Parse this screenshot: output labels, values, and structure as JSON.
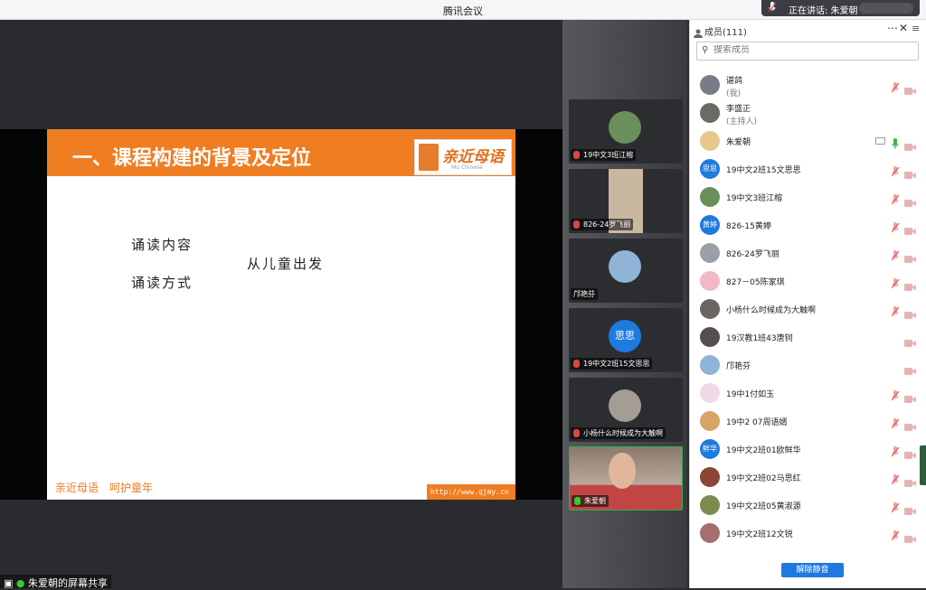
{
  "window": {
    "title": "腾讯会议"
  },
  "speaking": {
    "text": "正在讲话: 朱爱朝"
  },
  "share": {
    "label": "朱爱朝的屏幕共享"
  },
  "slide": {
    "title": "一、课程构建的背景及定位",
    "logo_text": "亲近母语",
    "logo_sub": "Mu Chinese",
    "lines": [
      "诵读内容",
      "从儿童出发",
      "诵读方式"
    ],
    "footer_left": "亲近母语　呵护童年",
    "footer_right": "http://www.qjmy.cn"
  },
  "tiles": [
    {
      "name": "19中文3班江榕",
      "mic": "muted",
      "avatar_color": "#6b8f5a"
    },
    {
      "name": "826-24罗飞丽",
      "mic": "muted",
      "avatar_color": "#c9b7a0"
    },
    {
      "name": "邝艳芬",
      "mic": "none",
      "avatar_color": "#8fb4d8"
    },
    {
      "name": "19中文2班15文思思",
      "mic": "muted",
      "avatar_text": "思思",
      "avatar_color": "#1f7ae0"
    },
    {
      "name": "小杨什么时候成为大触啊",
      "mic": "muted",
      "avatar_color": "#a49d94"
    },
    {
      "name": "朱爱朝",
      "mic": "on",
      "avatar_color": "#a45545"
    }
  ],
  "members": {
    "title": "成员(111)",
    "search_placeholder": "搜索成员",
    "unmute_all": "解除静音",
    "list": [
      {
        "name": "谌鸽",
        "sub": "(我)",
        "avatar_color": "#777d86",
        "mic": "muted",
        "cam": true
      },
      {
        "name": "李盛正",
        "sub": "(主持人)",
        "avatar_color": "#6d6a66",
        "mic": "none",
        "cam": false
      },
      {
        "name": "朱爱朝",
        "avatar_color": "#e8c88a",
        "mic": "on",
        "cam": true,
        "screen": true
      },
      {
        "name": "19中文2班15文思思",
        "avatar_text": "思思",
        "avatar_color": "#1f7ae0",
        "mic": "muted",
        "cam": true
      },
      {
        "name": "19中文3班江榕",
        "avatar_color": "#6b8f5a",
        "mic": "muted",
        "cam": true
      },
      {
        "name": "826-15黄婷",
        "avatar_text": "黄婷",
        "avatar_color": "#1f7ae0",
        "mic": "muted",
        "cam": true
      },
      {
        "name": "826-24罗飞丽",
        "avatar_color": "#9aa0a8",
        "mic": "muted",
        "cam": true
      },
      {
        "name": "827－05陈家琪",
        "avatar_color": "#f1b9c6",
        "mic": "muted",
        "cam": true
      },
      {
        "name": "小杨什么时候成为大触啊",
        "avatar_color": "#6a6562",
        "mic": "muted",
        "cam": true
      },
      {
        "name": "19汉教1班43唐钶",
        "avatar_color": "#55504e",
        "mic": "none",
        "cam": true
      },
      {
        "name": "邝艳芬",
        "avatar_color": "#8fb4d8",
        "mic": "none",
        "cam": true
      },
      {
        "name": "19中1付如玉",
        "avatar_color": "#f0d9e8",
        "mic": "muted",
        "cam": true
      },
      {
        "name": "19中2 07周语婿",
        "avatar_color": "#d6a468",
        "mic": "muted",
        "cam": true
      },
      {
        "name": "19中文2班01欧鲜华",
        "avatar_text": "鲜华",
        "avatar_color": "#1f7ae0",
        "mic": "muted",
        "cam": true
      },
      {
        "name": "19中文2班02马思红",
        "avatar_color": "#8a4535",
        "mic": "muted",
        "cam": true
      },
      {
        "name": "19中文2班05黄淑源",
        "avatar_color": "#7d8b4f",
        "mic": "muted",
        "cam": true
      },
      {
        "name": "19中文2班12文锐",
        "avatar_color": "#a36f6f",
        "mic": "muted",
        "cam": true
      }
    ]
  }
}
